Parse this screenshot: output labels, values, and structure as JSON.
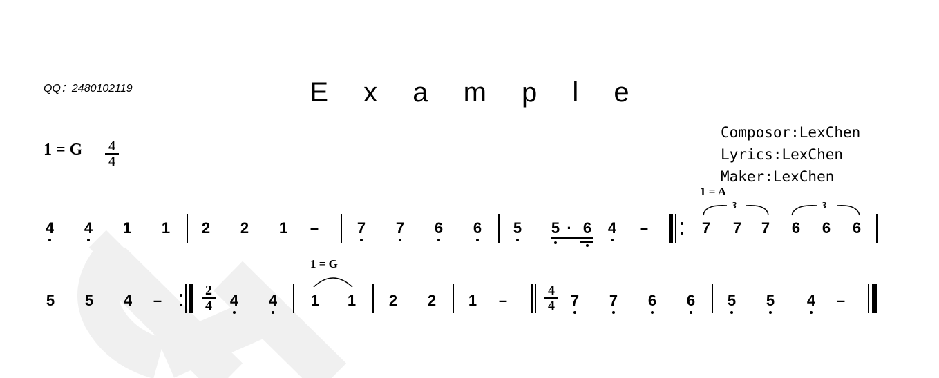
{
  "header": {
    "qq": "QQ：2480102119",
    "title": "E x a m p l e",
    "composer": "Composor:LexChen",
    "lyrics": "Lyrics:LexChen",
    "maker": "Maker:LexChen",
    "key": "1 = G",
    "time_top": "4",
    "time_bottom": "4"
  },
  "line1": {
    "notes": [
      "4",
      "4",
      "1",
      "1",
      "2",
      "2",
      "1",
      "–",
      "7",
      "7",
      "6",
      "6",
      "5",
      "5",
      "·",
      "6",
      "4",
      "–",
      "7",
      "7",
      "7",
      "6",
      "6",
      "6"
    ],
    "key_change": "1 = A",
    "triplet": "3"
  },
  "line2": {
    "notes": [
      "5",
      "5",
      "4",
      "–",
      "4",
      "4",
      "1",
      "1",
      "2",
      "2",
      "1",
      "–",
      "7",
      "7",
      "6",
      "6",
      "5",
      "5",
      "4",
      "–"
    ],
    "time_change1_top": "2",
    "time_change1_bottom": "4",
    "time_change2_top": "4",
    "time_change2_bottom": "4",
    "key_change": "1 = G"
  },
  "colors": {
    "ink": "#000000",
    "watermark": "#f0f0f0"
  }
}
